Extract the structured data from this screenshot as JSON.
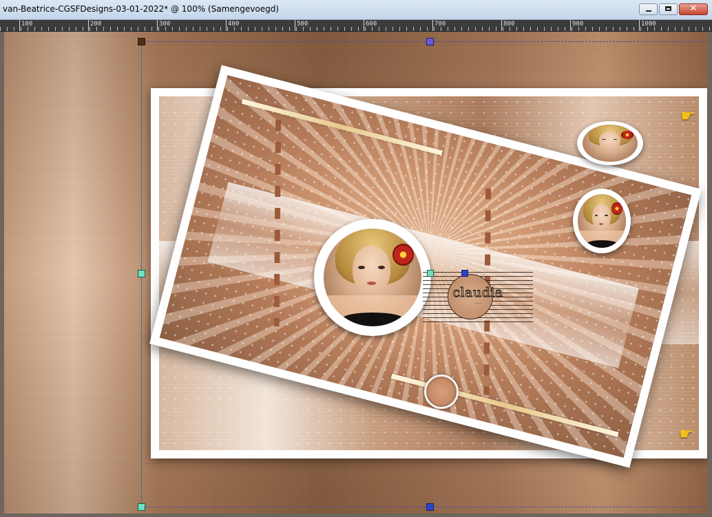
{
  "window": {
    "title": "van-Beatrice-CGSFDesigns-03-01-2022* @ 100% (Samengevoegd)",
    "buttons": {
      "minimize": "minimize",
      "maximize": "maximize",
      "close": "close"
    }
  },
  "ruler": {
    "labels": [
      "100",
      "200",
      "300",
      "400",
      "500",
      "600",
      "700",
      "800",
      "900",
      "1000"
    ]
  },
  "canvas": {
    "logo_text": "claudia",
    "logo_subtext": "······",
    "icons": [
      "pointing-hand-icon",
      "pointing-hand-icon"
    ]
  },
  "colors": {
    "titlebar": "#c4d6ea",
    "selection_line": "#4a4aa8",
    "handle_purple": "#6a58d8",
    "handle_teal": "#6fe0c0",
    "handle_dark": "#4e2f1a",
    "hand_icon": "#f6c21a"
  }
}
